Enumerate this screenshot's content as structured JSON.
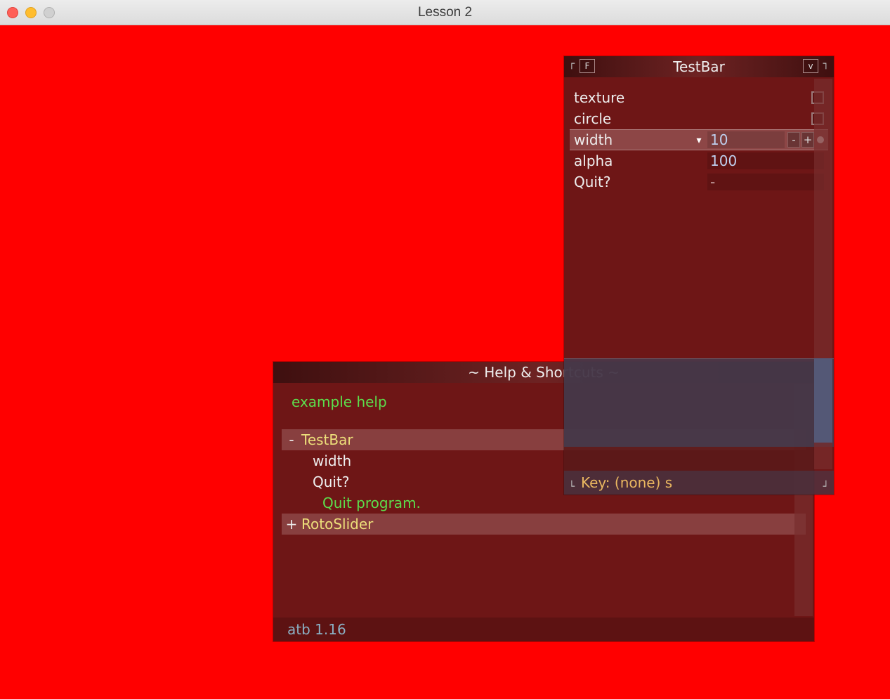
{
  "window": {
    "title": "Lesson 2"
  },
  "testbar": {
    "title": "TestBar",
    "rows": {
      "texture_label": "texture",
      "circle_label": "circle",
      "width_label": "width",
      "width_value": "10",
      "alpha_label": "alpha",
      "alpha_value": "100",
      "quit_label": "Quit?",
      "quit_value": "-"
    },
    "footer": "Key: (none)  s"
  },
  "helpbar": {
    "title": "~ Help & Shortcuts ~",
    "example_help": "example help",
    "section_testbar": "TestBar",
    "item_width": "width",
    "item_quit": "Quit?",
    "quit_help": "Quit program.",
    "section_rotoslider": "RotoSlider",
    "footer": "atb  1.16",
    "expander_minus": "-",
    "expander_plus": "+"
  }
}
